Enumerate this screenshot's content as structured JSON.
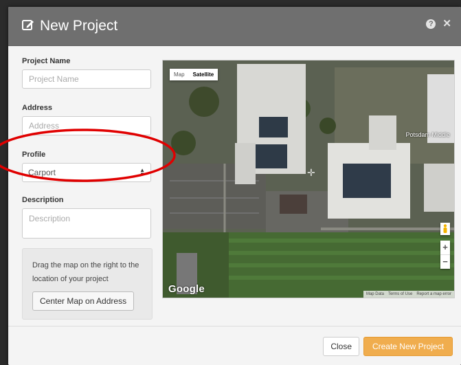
{
  "modal": {
    "title": "New Project",
    "help_icon": "question-circle-icon",
    "close_icon": "close-icon"
  },
  "form": {
    "project_name": {
      "label": "Project Name",
      "placeholder": "Project Name",
      "value": ""
    },
    "address": {
      "label": "Address",
      "placeholder": "Address",
      "value": ""
    },
    "profile": {
      "label": "Profile",
      "selected": "Carport"
    },
    "description": {
      "label": "Description",
      "placeholder": "Description",
      "value": ""
    }
  },
  "hint": {
    "text": "Drag the map on the right to the location of your project",
    "center_button": "Center Map on Address"
  },
  "map": {
    "types": [
      "Map",
      "Satellite"
    ],
    "active_type": "Satellite",
    "place_label": "Potsdam Middle",
    "logo": "Google",
    "attribution": [
      "Map Data",
      "Terms of Use",
      "Report a map error"
    ]
  },
  "footer": {
    "close_label": "Close",
    "create_label": "Create New Project"
  },
  "colors": {
    "header_bg": "#6f6f6f",
    "primary_button": "#f0ad4e",
    "annotation_circle": "#e00000"
  }
}
